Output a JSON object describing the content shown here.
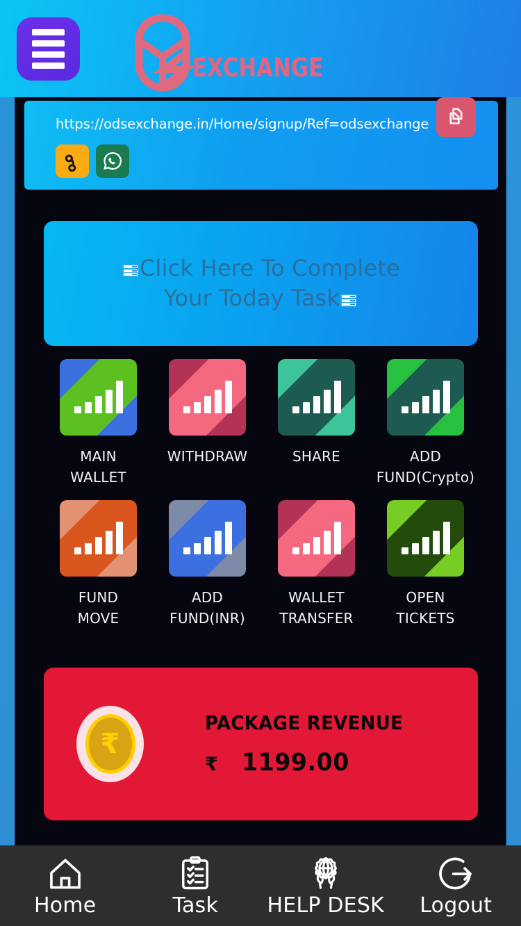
{
  "header": {
    "menu_icon": "hamburger-icon",
    "logo_icon": "ods-logo-icon",
    "wordmark": "EXCHANGE",
    "brand_color": "#e8637f",
    "menu_button_color": "#6b2fe8"
  },
  "referral": {
    "url": "https://odsexchange.in/Home/signup/Ref=odsexchange",
    "copy_icon": "copy-icon",
    "copy_button_color": "#d9566f",
    "actions": [
      {
        "name": "copy-link",
        "icon": "chain-link-icon",
        "color": "#f9ab13"
      },
      {
        "name": "whatsapp-share",
        "icon": "whatsapp-icon",
        "color": "#1a7a50"
      }
    ]
  },
  "task_banner": {
    "text_line_1": "Click Here To Complete",
    "text_line_2": "Your Today Task",
    "leading_icon": "form-list-icon",
    "trailing_icon": "form-list-icon",
    "text_color": "#2a6f9e"
  },
  "tiles": [
    [
      {
        "label": "MAIN\nWALLET",
        "icon": "bar-chart-icon",
        "base": "#5cc021",
        "accent": "#3c6fe0"
      },
      {
        "label": "WITHDRAW",
        "icon": "bar-chart-icon",
        "base": "#f4697f",
        "accent": "#b23355"
      },
      {
        "label": "SHARE",
        "icon": "bar-chart-icon",
        "base": "#1d5b52",
        "accent": "#3ec49a"
      },
      {
        "label": "ADD\nFUND(Crypto)",
        "icon": "bar-chart-icon",
        "base": "#1d5b52",
        "accent": "#27c03f"
      }
    ],
    [
      {
        "label": "FUND\nMOVE",
        "icon": "bar-chart-icon",
        "base": "#d9561f",
        "accent": "#e29272"
      },
      {
        "label": "ADD\nFUND(INR)",
        "icon": "bar-chart-icon",
        "base": "#3c6fe0",
        "accent": "#7d8ba8"
      },
      {
        "label": "WALLET\nTRANSFER",
        "icon": "bar-chart-icon",
        "base": "#f4697f",
        "accent": "#b23355"
      },
      {
        "label": "OPEN\nTICKETS",
        "icon": "bar-chart-icon",
        "base": "#234b0b",
        "accent": "#77cd24"
      }
    ]
  ],
  "revenue": {
    "title": "PACKAGE REVENUE",
    "currency_symbol": "₹",
    "amount": "1199.00",
    "coin_icon": "rupee-coin-icon",
    "card_color": "#e31837"
  },
  "bottom_nav": [
    {
      "label": "Home",
      "icon": "home-icon"
    },
    {
      "label": "Task",
      "icon": "clipboard-checklist-icon"
    },
    {
      "label": "HELP DESK",
      "icon": "globe-support-icon"
    },
    {
      "label": "Logout",
      "icon": "logout-arrow-icon"
    }
  ]
}
